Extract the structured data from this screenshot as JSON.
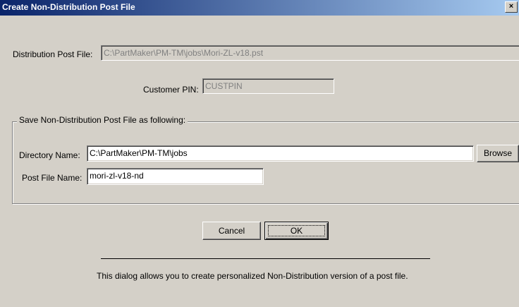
{
  "window": {
    "title": "Create Non-Distribution Post File",
    "close_glyph": "×"
  },
  "distribution": {
    "label": "Distribution Post File:",
    "value": "C:\\PartMaker\\PM-TM\\jobs\\Mori-ZL-v18.pst"
  },
  "customer_pin": {
    "label": "Customer PIN:",
    "value": "CUSTPIN"
  },
  "save_group": {
    "legend": "Save Non-Distribution Post File as following:",
    "directory_label": "Directory Name:",
    "directory_value": "C:\\PartMaker\\PM-TM\\jobs",
    "browse_label": "Browse",
    "postfile_label": "Post File Name:",
    "postfile_value": "mori-zl-v18-nd"
  },
  "buttons": {
    "cancel": "Cancel",
    "ok": "OK"
  },
  "info_text": "This dialog allows you to create personalized Non-Distribution version of a post file."
}
